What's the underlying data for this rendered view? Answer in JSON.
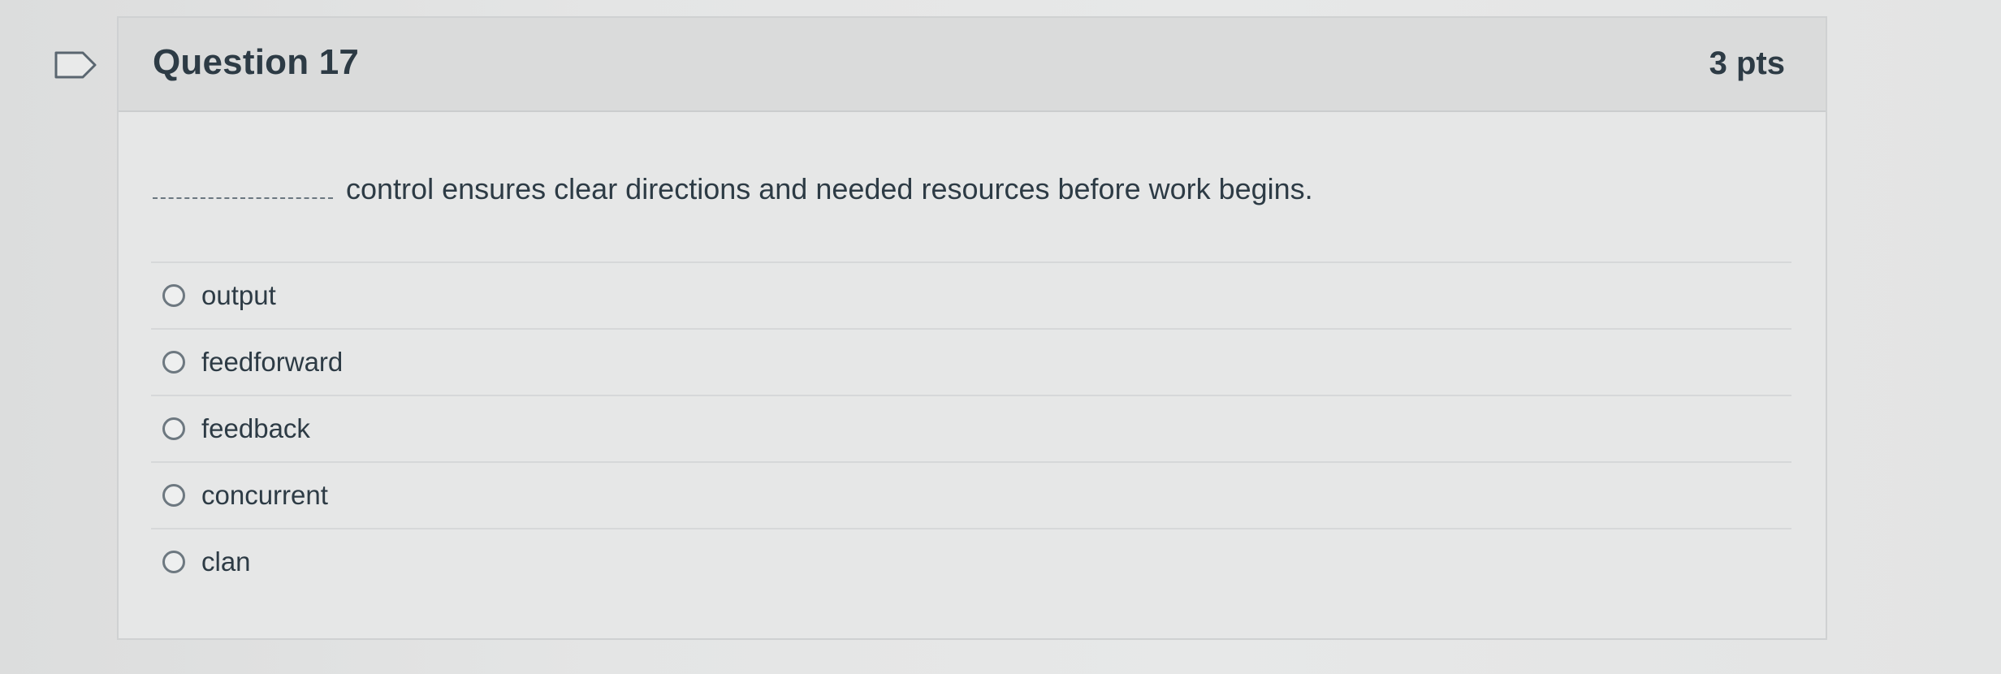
{
  "question": {
    "title": "Question 17",
    "points": "3 pts",
    "text": "control ensures clear directions and needed resources before work begins.",
    "flag_icon": "flag-icon",
    "answers": [
      {
        "label": "output",
        "selected": false
      },
      {
        "label": "feedforward",
        "selected": false
      },
      {
        "label": "feedback",
        "selected": false
      },
      {
        "label": "concurrent",
        "selected": false
      },
      {
        "label": "clan",
        "selected": false
      }
    ]
  }
}
